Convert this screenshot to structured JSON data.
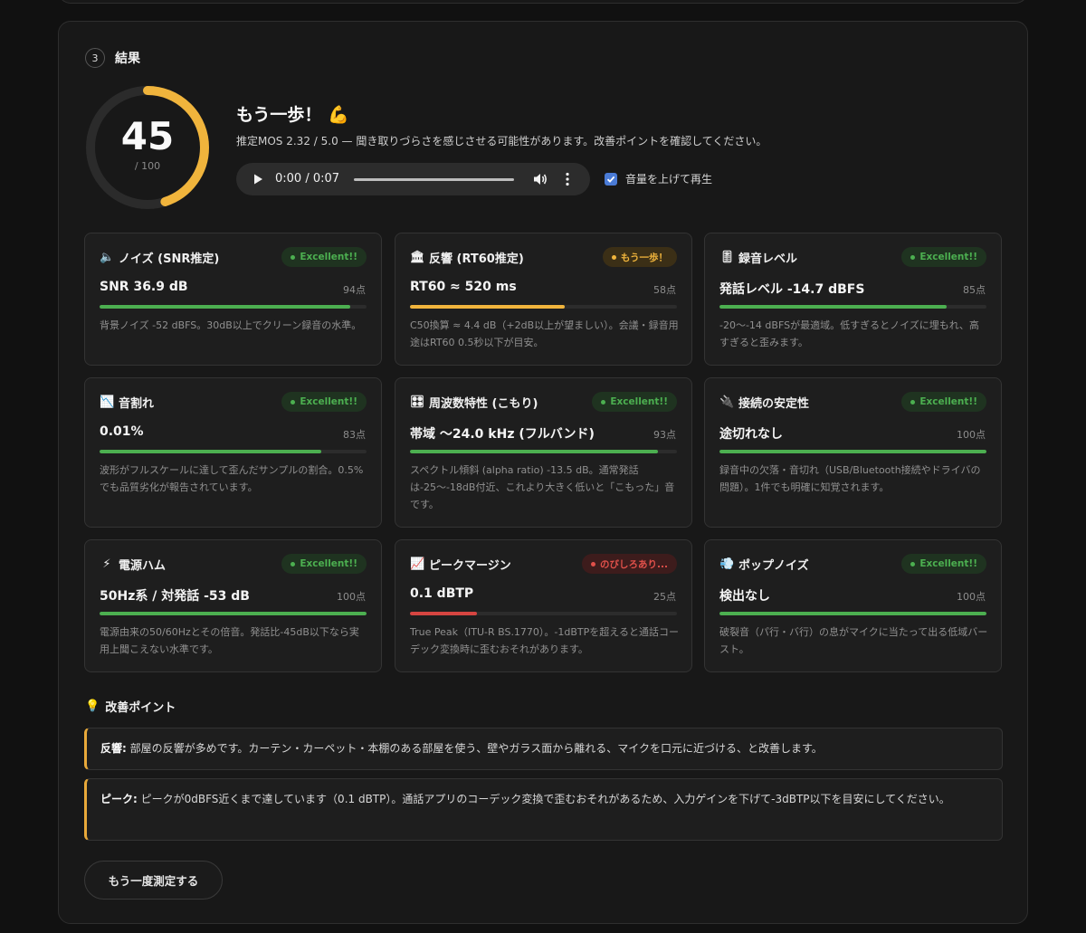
{
  "step": {
    "number": "3",
    "title": "結果"
  },
  "score": {
    "value": "45",
    "max": "/ 100",
    "fraction": 0.45,
    "color": "#f0b43c"
  },
  "verdict": {
    "title": "もう一歩！",
    "emoji": "💪",
    "description": "推定MOS 2.32 / 5.0 — 聞き取りづらさを感じさせる可能性があります。改善ポイントを確認してください。"
  },
  "player": {
    "time": "0:00 / 0:07"
  },
  "boost": {
    "label": "音量を上げて再生",
    "checked": true
  },
  "metrics": [
    {
      "icon": "🔈",
      "title": "ノイズ (SNR推定)",
      "badge": "Excellent!!",
      "badge_level": "good",
      "value": "SNR 36.9 dB",
      "score": "94点",
      "fill": 0.94,
      "color": "#4caf50",
      "desc": "背景ノイズ -52 dBFS。30dB以上でクリーン録音の水準。"
    },
    {
      "icon": "🏛",
      "title": "反響 (RT60推定)",
      "badge": "もう一歩！",
      "badge_level": "mid",
      "value": "RT60 ≈ 520 ms",
      "score": "58点",
      "fill": 0.58,
      "color": "#f0b43c",
      "desc": "C50換算 ≈ 4.4 dB（+2dB以上が望ましい）。会議・録音用途はRT60 0.5秒以下が目安。"
    },
    {
      "icon": "🎚",
      "title": "録音レベル",
      "badge": "Excellent!!",
      "badge_level": "good",
      "value": "発話レベル -14.7 dBFS",
      "score": "85点",
      "fill": 0.85,
      "color": "#4caf50",
      "desc": "-20〜-14 dBFSが最適域。低すぎるとノイズに埋もれ、高すぎると歪みます。"
    },
    {
      "icon": "📉",
      "title": "音割れ",
      "badge": "Excellent!!",
      "badge_level": "good",
      "value": "0.01%",
      "score": "83点",
      "fill": 0.83,
      "color": "#4caf50",
      "desc": "波形がフルスケールに達して歪んだサンプルの割合。0.5%でも品質劣化が報告されています。"
    },
    {
      "icon": "🎛",
      "title": "周波数特性 (こもり)",
      "badge": "Excellent!!",
      "badge_level": "good",
      "value": "帯域 〜24.0 kHz (フルバンド)",
      "score": "93点",
      "fill": 0.93,
      "color": "#4caf50",
      "desc": "スペクトル傾斜 (alpha ratio) -13.5 dB。通常発話は-25〜-18dB付近、これより大きく低いと「こもった」音です。"
    },
    {
      "icon": "🔌",
      "title": "接続の安定性",
      "badge": "Excellent!!",
      "badge_level": "good",
      "value": "途切れなし",
      "score": "100点",
      "fill": 1.0,
      "color": "#4caf50",
      "desc": "録音中の欠落・音切れ（USB/Bluetooth接続やドライバの問題）。1件でも明確に知覚されます。"
    },
    {
      "icon": "⚡",
      "title": "電源ハム",
      "badge": "Excellent!!",
      "badge_level": "good",
      "value": "50Hz系 / 対発話 -53 dB",
      "score": "100点",
      "fill": 1.0,
      "color": "#4caf50",
      "desc": "電源由来の50/60Hzとその倍音。発話比-45dB以下なら実用上聞こえない水準です。"
    },
    {
      "icon": "📈",
      "title": "ピークマージン",
      "badge": "のびしろあり...",
      "badge_level": "bad",
      "value": "0.1 dBTP",
      "score": "25点",
      "fill": 0.25,
      "color": "#d64541",
      "desc": "True Peak（ITU-R BS.1770）。-1dBTPを超えると通話コーデック変換時に歪むおそれがあります。"
    },
    {
      "icon": "💨",
      "title": "ポップノイズ",
      "badge": "Excellent!!",
      "badge_level": "good",
      "value": "検出なし",
      "score": "100点",
      "fill": 1.0,
      "color": "#4caf50",
      "desc": "破裂音（パ行・バ行）の息がマイクに当たって出る低域バースト。"
    }
  ],
  "improvements": {
    "title": "改善ポイント",
    "items": [
      {
        "label": "反響:",
        "text": " 部屋の反響が多めです。カーテン・カーペット・本棚のある部屋を使う、壁やガラス面から離れる、マイクを口元に近づける、と改善します。"
      },
      {
        "label": "ピーク:",
        "text": " ピークが0dBFS近くまで達しています（0.1 dBTP）。通話アプリのコーデック変換で歪むおそれがあるため、入力ゲインを下げて-3dBTP以下を目安にしてください。"
      }
    ]
  },
  "retry_label": "もう一度測定する"
}
